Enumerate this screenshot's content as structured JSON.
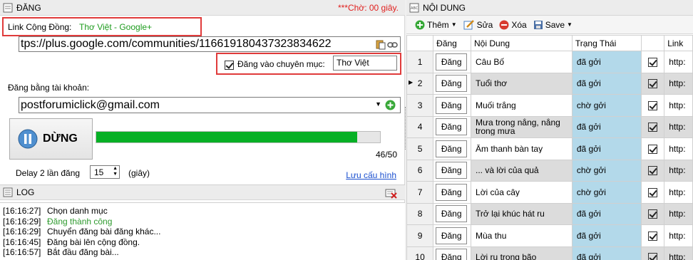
{
  "left_panel": {
    "title": "ĐĂNG",
    "countdown": "***Chờ: 00 giây.",
    "community_label": "Link Cộng Đồng:",
    "community_name": "Thơ Việt - Google+",
    "community_url": "tps://plus.google.com/communities/116619180437323834622",
    "category_checkbox_label": "Đăng vào chuyên mục:",
    "category_value": "Thơ Việt",
    "account_label": "Đăng bằng tài khoản:",
    "account_value": "postforumiclick@gmail.com",
    "stop_button": "DỪNG",
    "progress_fraction": 0.92,
    "progress_text": "46/50",
    "delay_label": "Delay 2 lần đăng",
    "delay_value": "15",
    "delay_unit": "(giây)",
    "save_config_link": "Lưu cấu hình"
  },
  "log_panel": {
    "title": "LOG",
    "rows": [
      {
        "time": "[16:16:27]",
        "msg": "Chọn danh mục",
        "color": "#000000"
      },
      {
        "time": "[16:16:29]",
        "msg": "Đăng thành công",
        "color": "#2e9a2e"
      },
      {
        "time": "[16:16:29]",
        "msg": "Chuyển đăng bài đăng khác...",
        "color": "#000000"
      },
      {
        "time": "[16:16:45]",
        "msg": "Đăng bài lên cộng đồng.",
        "color": "#000000"
      },
      {
        "time": "[16:16:57]",
        "msg": "Bắt đầu đăng bài...",
        "color": "#000000"
      }
    ]
  },
  "right_panel": {
    "title": "NỘI DUNG",
    "toolbar": {
      "add": "Thêm",
      "edit": "Sửa",
      "delete": "Xóa",
      "save": "Save"
    },
    "columns": [
      "Đăng",
      "Nội Dung",
      "Trạng Thái",
      "",
      "Link"
    ],
    "rows": [
      {
        "num": "1",
        "btn": "Đăng",
        "content": "Câu Bố",
        "status": "đã gởi",
        "checked": true,
        "link": "http:"
      },
      {
        "num": "2",
        "btn": "Đăng",
        "content": "Tuổi thơ",
        "status": "đã gởi",
        "checked": true,
        "link": "http:"
      },
      {
        "num": "3",
        "btn": "Đăng",
        "content": "Muối trắng",
        "status": "chờ gởi",
        "checked": true,
        "link": "http:"
      },
      {
        "num": "4",
        "btn": "Đăng",
        "content": "Mưa trong nắng, nắng trong mưa",
        "status": "đã gởi",
        "checked": true,
        "link": "http:"
      },
      {
        "num": "5",
        "btn": "Đăng",
        "content": "Âm thanh bàn tay",
        "status": "đã gởi",
        "checked": true,
        "link": "http:"
      },
      {
        "num": "6",
        "btn": "Đăng",
        "content": "... và lời của quả",
        "status": "chờ gởi",
        "checked": true,
        "link": "http:"
      },
      {
        "num": "7",
        "btn": "Đăng",
        "content": "Lời của cây",
        "status": "chờ gởi",
        "checked": true,
        "link": "http:"
      },
      {
        "num": "8",
        "btn": "Đăng",
        "content": "Trở lại khúc hát ru",
        "status": "đã gởi",
        "checked": true,
        "link": "http:"
      },
      {
        "num": "9",
        "btn": "Đăng",
        "content": "Mùa thu",
        "status": "đã gởi",
        "checked": true,
        "link": "http:"
      },
      {
        "num": "10",
        "btn": "Đăng",
        "content": "Lời ru trong bão",
        "status": "đã gởi",
        "checked": true,
        "link": "http:"
      }
    ]
  }
}
